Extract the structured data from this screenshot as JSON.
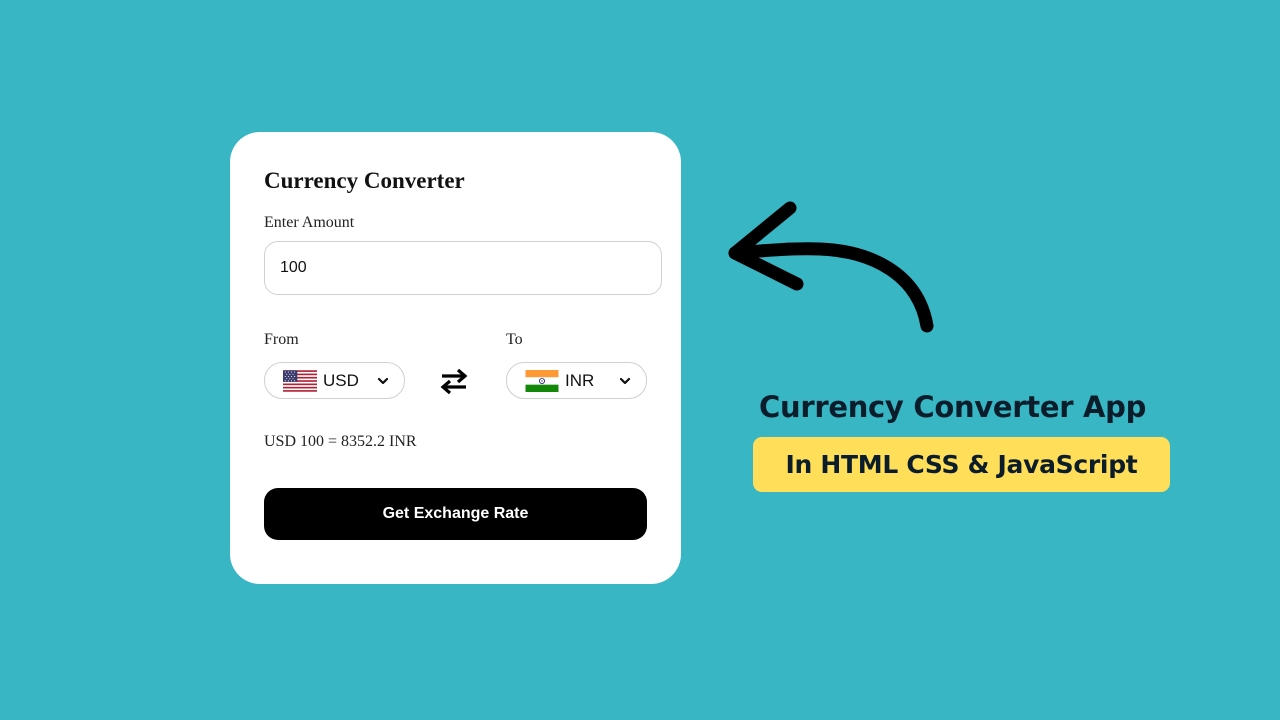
{
  "converter": {
    "title": "Currency Converter",
    "amount_label": "Enter Amount",
    "amount_value": "100",
    "from_label": "From",
    "to_label": "To",
    "from_currency": {
      "code": "USD",
      "flag_icon": "us-flag-icon"
    },
    "to_currency": {
      "code": "INR",
      "flag_icon": "india-flag-icon"
    },
    "result": "USD 100 = 8352.2 INR",
    "button_label": "Get Exchange Rate"
  },
  "promo": {
    "headline": "Currency Converter App",
    "subheadline": "In HTML CSS & JavaScript",
    "arrow_icon": "curved-arrow-icon"
  },
  "colors": {
    "background": "#38b6c4",
    "card": "#ffffff",
    "button": "#000000",
    "highlight": "#ffde59",
    "headline_text": "#0b1d2b"
  }
}
